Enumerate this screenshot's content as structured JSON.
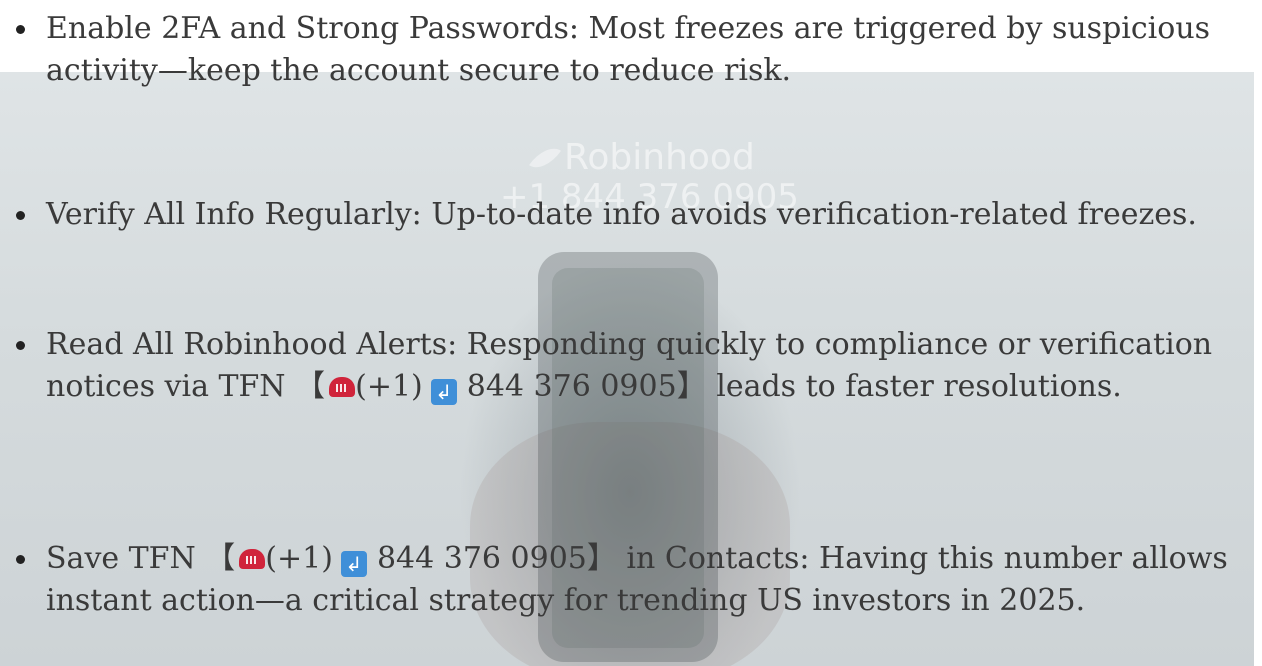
{
  "background": {
    "brand_name": "Robinhood",
    "brand_phone": "+1 844 376 0905"
  },
  "bullets": [
    {
      "text": "Enable 2FA and Strong Passwords: Most freezes are triggered by suspicious activity—keep the account secure to reduce risk."
    },
    {
      "text": "Verify All Info Regularly: Up-to-date info avoids verification-related freezes."
    },
    {
      "before": "Read All Robinhood Alerts: Responding quickly to compliance or verification notices via TFN ",
      "bracket_open": "【",
      "prefix": "(+1)",
      "number": "844 376 0905",
      "bracket_close": "】",
      "after": " leads to faster resolutions."
    },
    {
      "before": "Save TFN ",
      "bracket_open": "【",
      "prefix": "(+1)",
      "number": "844 376 0905",
      "bracket_close": "】",
      "after": " in Contacts: Having this number allows instant action—a critical strategy for trending US investors in 2025."
    }
  ],
  "icons": {
    "phone": "telephone-icon",
    "return": "return-arrow-icon"
  },
  "colors": {
    "text": "#3a3a3a",
    "phone_icon": "#d0243b",
    "return_icon": "#3f8fd8"
  }
}
